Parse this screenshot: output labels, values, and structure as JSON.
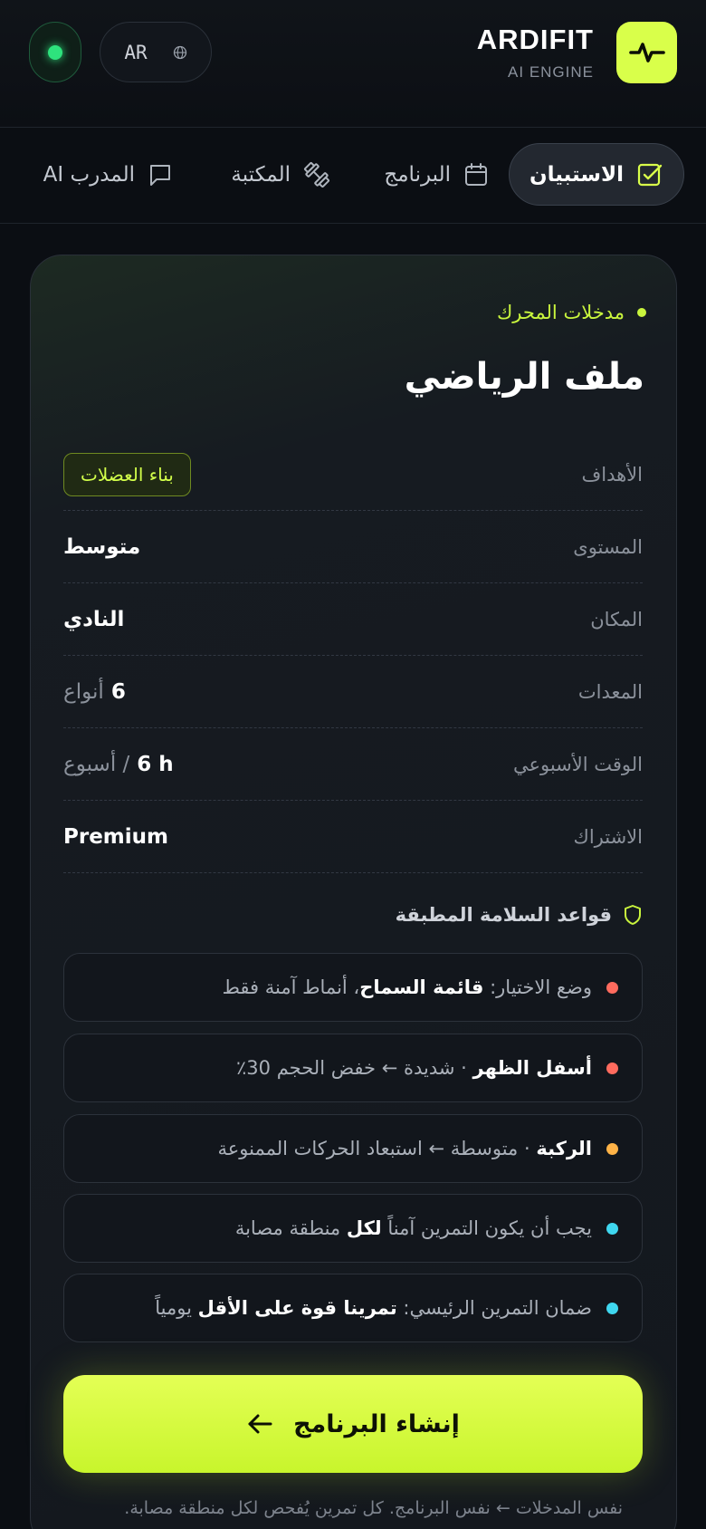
{
  "header": {
    "brand_name": "ARDIFIT",
    "brand_sub": "AI ENGINE",
    "logo_icon": "pulse-icon",
    "language": "AR",
    "status_color": "#2ee27d"
  },
  "tabs": [
    {
      "label": "الاستبيان",
      "icon": "checkbox-icon",
      "active": true
    },
    {
      "label": "البرنامج",
      "icon": "calendar-icon",
      "active": false
    },
    {
      "label": "المكتبة",
      "icon": "dumbbell-icon",
      "active": false
    },
    {
      "label": "المدرب AI",
      "icon": "chat-icon",
      "active": false
    }
  ],
  "profile": {
    "section_label": "مدخلات المحرك",
    "title": "ملف الرياضي",
    "rows": [
      {
        "label": "الأهداف",
        "value": "بناء العضلات"
      },
      {
        "label": "المستوى",
        "value": "متوسط"
      },
      {
        "label": "المكان",
        "value": "النادي"
      },
      {
        "label": "المعدات",
        "value_main": "6",
        "value_suffix": "أنواع"
      },
      {
        "label": "الوقت الأسبوعي",
        "value_main": "6 h",
        "value_suffix": "/ أسبوع"
      },
      {
        "label": "الاشتراك",
        "value": "Premium"
      }
    ]
  },
  "safety": {
    "heading": "قواعد السلامة المطبقة",
    "rules": [
      {
        "color": "#ff6b5e",
        "pre": "وضع الاختيار: ",
        "bold": "قائمة السماح",
        "post": "، أنماط آمنة فقط"
      },
      {
        "color": "#ff6b5e",
        "pre": "",
        "bold": "أسفل الظهر",
        "post": " · شديدة ← خفض الحجم 30٪"
      },
      {
        "color": "#ffb347",
        "pre": "",
        "bold": "الركبة",
        "post": " · متوسطة ← استبعاد الحركات الممنوعة"
      },
      {
        "color": "#3fd7ef",
        "pre": "يجب أن يكون التمرين آمناً ",
        "bold": "لكل",
        "post": " منطقة مصابة"
      },
      {
        "color": "#3fd7ef",
        "pre": "ضمان التمرين الرئيسي: ",
        "bold": "تمرينا قوة على الأقل",
        "post": " يومياً"
      }
    ]
  },
  "cta": {
    "label": "إنشاء البرنامج",
    "icon": "arrow-left-icon"
  },
  "footnote": "نفس المدخلات ← نفس البرنامج. كل تمرين يُفحص لكل منطقة مصابة."
}
